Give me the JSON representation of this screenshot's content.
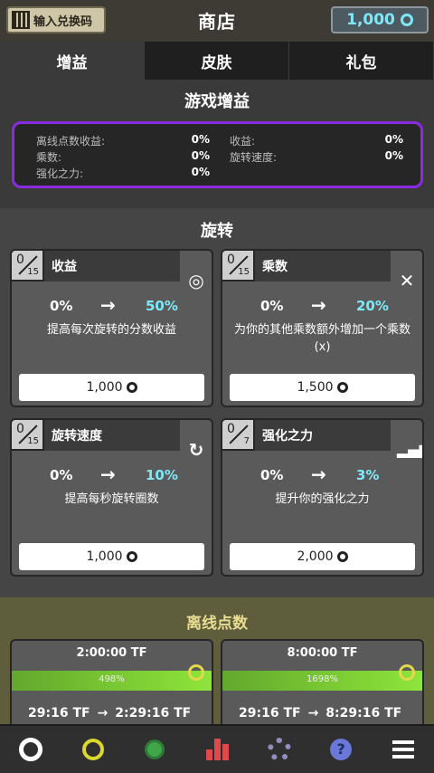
{
  "header": {
    "redeem_label": "输入兑换码",
    "title": "商店",
    "coins": "1,000"
  },
  "tabs": [
    {
      "label": "增益",
      "active": true
    },
    {
      "label": "皮肤"
    },
    {
      "label": "礼包"
    }
  ],
  "game_gains": {
    "title": "游戏增益",
    "stats": [
      {
        "label": "离线点数收益:",
        "value": "0%"
      },
      {
        "label": "收益:",
        "value": "0%"
      },
      {
        "label": "乘数:",
        "value": "0%"
      },
      {
        "label": "旋转速度:",
        "value": "0%"
      },
      {
        "label": "强化之力:",
        "value": "0%"
      }
    ]
  },
  "spin": {
    "title": "旋转",
    "cards": [
      {
        "count": "0",
        "max": "15",
        "name": "收益",
        "icon": "target-icon",
        "from": "0%",
        "to": "50%",
        "desc": "提高每次旋转的分数收益",
        "price": "1,000"
      },
      {
        "count": "0",
        "max": "15",
        "name": "乘数",
        "icon": "multiply-icon",
        "from": "0%",
        "to": "20%",
        "desc": "为你的其他乘数额外增加一个乘数 (x)",
        "price": "1,500"
      },
      {
        "count": "0",
        "max": "15",
        "name": "旋转速度",
        "icon": "rotate-icon",
        "from": "0%",
        "to": "10%",
        "desc": "提高每秒旋转圈数",
        "price": "1,000"
      },
      {
        "count": "0",
        "max": "7",
        "name": "强化之力",
        "icon": "bar-chart-icon",
        "from": "0%",
        "to": "3%",
        "desc": "提升你的强化之力",
        "price": "2,000"
      }
    ]
  },
  "offline": {
    "title": "离线点数",
    "cards": [
      {
        "time": "2:00:00 TF",
        "progress_label": "498%",
        "progress": 1.0,
        "from": "29:16 TF",
        "to": "2:29:16 TF"
      },
      {
        "time": "8:00:00 TF",
        "progress_label": "1698%",
        "progress": 1.0,
        "from": "29:16 TF",
        "to": "8:29:16 TF"
      }
    ]
  },
  "colors": {
    "accent": "#7fe8f7",
    "purple_border": "#8a2be2",
    "progress_green": "#8ee53a"
  }
}
